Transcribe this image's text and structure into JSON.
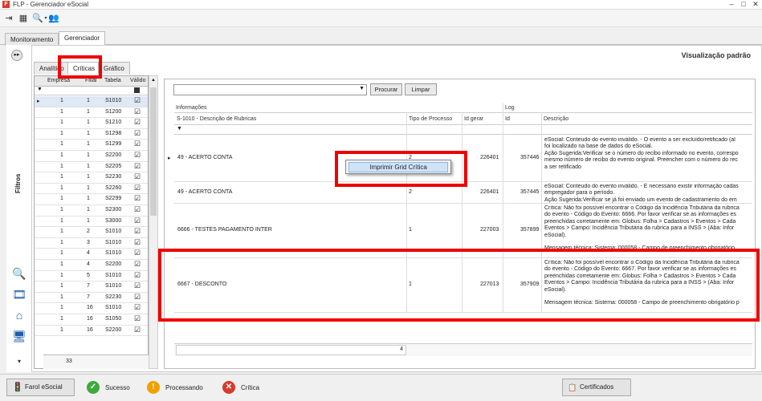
{
  "window": {
    "title": "FLP - Gerenciador eSocial",
    "app_icon_letter": "F",
    "controls": [
      "–",
      "□",
      "✕"
    ]
  },
  "toolbar": {
    "icons": [
      "exit-icon",
      "grid-icon",
      "search-icon",
      "users-icon"
    ]
  },
  "main_tabs": [
    {
      "label": "Monitoramento"
    },
    {
      "label": "Gerenciador"
    }
  ],
  "view_label": "Visualização padrão",
  "filters_label": "Filtros",
  "sub_tabs": [
    {
      "label": "Analítico"
    },
    {
      "label": "Críticas"
    },
    {
      "label": "Gráfico"
    }
  ],
  "left_grid": {
    "columns": [
      "Empresa",
      "Filial",
      "Tabela",
      "Válido"
    ],
    "rows": [
      {
        "empresa": "1",
        "filial": "1",
        "tabela": "S1010"
      },
      {
        "empresa": "1",
        "filial": "1",
        "tabela": "S1200"
      },
      {
        "empresa": "1",
        "filial": "1",
        "tabela": "S1210"
      },
      {
        "empresa": "1",
        "filial": "1",
        "tabela": "S1298"
      },
      {
        "empresa": "1",
        "filial": "1",
        "tabela": "S1299"
      },
      {
        "empresa": "1",
        "filial": "1",
        "tabela": "S2200"
      },
      {
        "empresa": "1",
        "filial": "1",
        "tabela": "S2205"
      },
      {
        "empresa": "1",
        "filial": "1",
        "tabela": "S2230"
      },
      {
        "empresa": "1",
        "filial": "1",
        "tabela": "S2260"
      },
      {
        "empresa": "1",
        "filial": "1",
        "tabela": "S2299"
      },
      {
        "empresa": "1",
        "filial": "1",
        "tabela": "S2300"
      },
      {
        "empresa": "1",
        "filial": "1",
        "tabela": "S3000"
      },
      {
        "empresa": "1",
        "filial": "2",
        "tabela": "S1010"
      },
      {
        "empresa": "1",
        "filial": "3",
        "tabela": "S1010"
      },
      {
        "empresa": "1",
        "filial": "4",
        "tabela": "S1010"
      },
      {
        "empresa": "1",
        "filial": "4",
        "tabela": "S2200"
      },
      {
        "empresa": "1",
        "filial": "5",
        "tabela": "S1010"
      },
      {
        "empresa": "1",
        "filial": "7",
        "tabela": "S1010"
      },
      {
        "empresa": "1",
        "filial": "7",
        "tabela": "S2230"
      },
      {
        "empresa": "1",
        "filial": "16",
        "tabela": "S1010"
      },
      {
        "empresa": "1",
        "filial": "16",
        "tabela": "S1050"
      },
      {
        "empresa": "1",
        "filial": "16",
        "tabela": "S2200"
      }
    ],
    "footer_count": "33"
  },
  "search": {
    "procurar_label": "Procurar",
    "limpar_label": "Limpar"
  },
  "right_grid": {
    "group_info": "Informações",
    "group_log": "Log",
    "columns": [
      "S-1010 - Descrição de Rubricas",
      "Tipo de Processo",
      "Id gerar",
      "Id",
      "Descrição"
    ],
    "rows": [
      {
        "descricao": "49 - ACERTO CONTA",
        "tipo": "2",
        "id_gerar": "226401",
        "id": "357446",
        "log": [
          "eSocial: Conteudo do evento inválido. - O evento a ser excluído/retificado (al",
          "foi localizado na base de dados do eSocial.",
          "Ação Sugerida:Verificar se o número do recibo informado no evento, correspo",
          "mesmo número de recibo do evento original. Preencher com o número do rec",
          "a ser retificado"
        ]
      },
      {
        "descricao": "49 - ACERTO CONTA",
        "tipo": "2",
        "id_gerar": "226401",
        "id": "357445",
        "log": [
          "eSocial: Conteudo do evento inválido. - É necessário existir informação cadas",
          "empregador para o período.",
          "Ação Sugerida:Verificar se já foi enviado um evento de cadastramento do em"
        ]
      },
      {
        "descricao": "6666 - TESTES PAGAMENTO INTER",
        "tipo": "1",
        "id_gerar": "227003",
        "id": "357899",
        "log": [
          "Crítica: Não foi possível encontrar o Código da Incidência Tributária da rubrica",
          "do evento - Código do Evento: 6666. Por favor verificar se as informações es",
          "preenchidas corretamente em: Globus: Folha > Cadastros > Eventos > Cada",
          "Eventos > Campo: Incidência Tributária da rubrica para a INSS > (Aba: Infor",
          "eSocial).",
          "",
          "Mensagem técnica: Sistema: 000058 - Campo de preenchimento obrigatório"
        ]
      },
      {
        "descricao": "6667 - DESCONTO",
        "tipo": "1",
        "id_gerar": "227013",
        "id": "357909",
        "log": [
          "Crítica: Não foi possível encontrar o Código da Incidência Tributária da rubrica",
          "do evento - Código do Evento: 6667. Por favor verificar se as informações es",
          "preenchidas corretamente em: Globus: Folha > Cadastros > Eventos > Cada",
          "Eventos > Campo: Incidência Tributária da rubrica para a INSS > (Aba: Infor",
          "eSocial).",
          "",
          "Mensagem técnica: Sistema: 000058 - Campo de preenchimento obrigatório p"
        ]
      }
    ],
    "footer_count": "4"
  },
  "context_menu": {
    "item": "Imprimir Grid Crítica"
  },
  "statusbar": {
    "farol_label": "Farol eSocial",
    "sucesso_label": "Sucesso",
    "processando_label": "Processando",
    "critica_label": "Crítica",
    "certificados_label": "Certificados"
  },
  "colors": {
    "highlight": "#e00000",
    "selection": "#cfe3f8",
    "success": "#3cab3c",
    "warning": "#f0a000",
    "error": "#d83a2a"
  }
}
